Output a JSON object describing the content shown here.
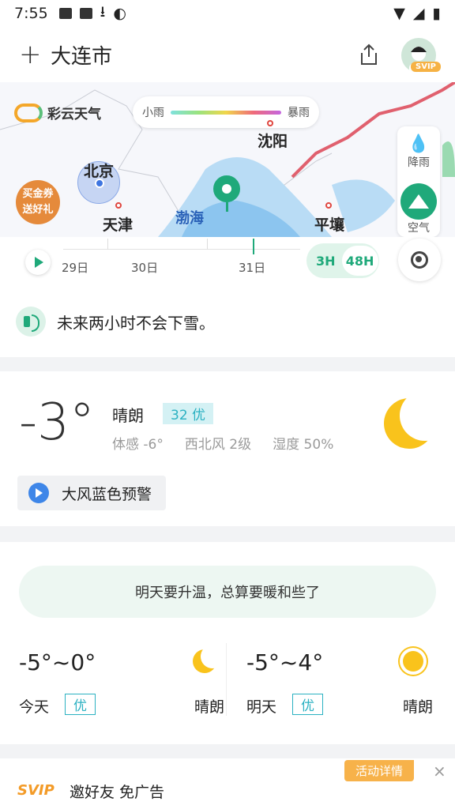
{
  "status_bar": {
    "time": "7:55"
  },
  "header": {
    "add_label": "+",
    "city": "大连市"
  },
  "avatar": {
    "badge": "SVIP"
  },
  "map": {
    "brand": "彩云天气",
    "legend": {
      "low": "小雨",
      "high": "暴雨"
    },
    "labels": {
      "shenyang": "沈阳",
      "beijing": "北京",
      "tianjin": "天津",
      "bohai": "渤海",
      "pyongyang": "平壤"
    },
    "promo": "买金券 送好礼",
    "side": {
      "rain": "降雨",
      "air": "空气"
    }
  },
  "timeline": {
    "days": [
      "29日",
      "30日",
      "31日"
    ],
    "modes": {
      "short": "3H",
      "long": "48H"
    }
  },
  "notice": {
    "text": "未来两小时不会下雪。"
  },
  "current": {
    "temp": "-3°",
    "condition": "晴朗",
    "aqi": "32 优",
    "feels": "体感 -6°",
    "wind": "西北风 2级",
    "humidity": "湿度 50%",
    "alert": "大风蓝色预警"
  },
  "forecast": {
    "tip": "明天要升温，总算要暖和些了",
    "today": {
      "range": "-5°~0°",
      "label": "今天",
      "quality": "优",
      "condition": "晴朗",
      "icon": "moon-icon"
    },
    "tomorrow": {
      "range": "-5°~4°",
      "label": "明天",
      "quality": "优",
      "condition": "晴朗",
      "icon": "sun-icon"
    }
  },
  "bottom": {
    "svip": "SVIP",
    "invite": "邀好友 免广告",
    "activity": "活动详情",
    "close": "×"
  },
  "colors": {
    "accent": "#1fa97a",
    "sun": "#f9c31c",
    "aqi": "#2bb1c2",
    "svip": "#f39b28"
  }
}
